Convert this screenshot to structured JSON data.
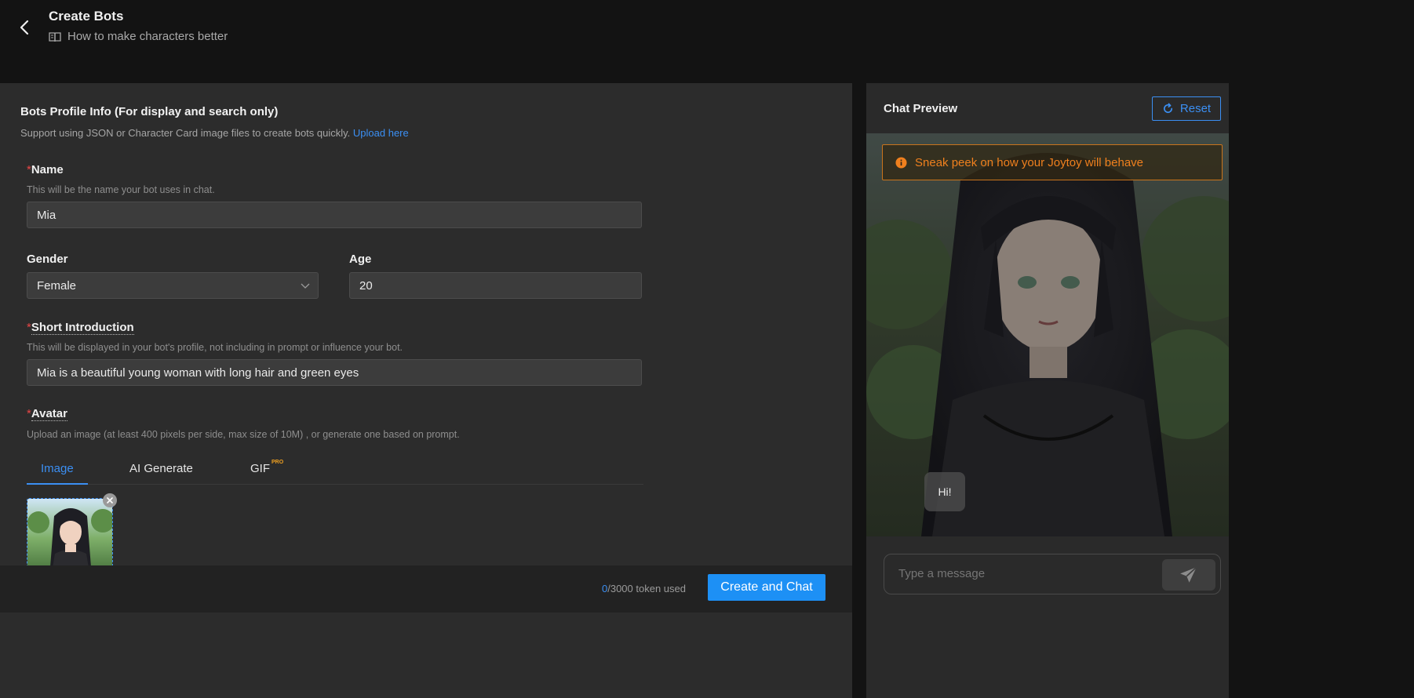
{
  "header": {
    "title": "Create Bots",
    "subtitle": "How to make characters better"
  },
  "profile": {
    "section_title": "Bots Profile Info (For display and search only)",
    "section_sub": "Support using JSON or Character Card image files to create bots quickly.",
    "upload_link": "Upload here",
    "required_mark": "*",
    "name": {
      "label": "Name",
      "help": "This will be the name your bot uses in chat.",
      "value": "Mia"
    },
    "gender": {
      "label": "Gender",
      "value": "Female"
    },
    "age": {
      "label": "Age",
      "value": "20"
    },
    "intro": {
      "label": "Short Introduction",
      "help": "This will be displayed in your bot's profile, not including in prompt or influence your bot.",
      "value": "Mia is a beautiful young woman with long hair and green eyes"
    },
    "avatar": {
      "label": "Avatar",
      "help": "Upload an image (at least 400 pixels per side, max size of 10M) , or generate one based on prompt.",
      "tabs": [
        "Image",
        "AI Generate",
        "GIF"
      ],
      "pro_badge": "PRO",
      "active_tab": "Image"
    }
  },
  "footer": {
    "token_used": "0",
    "token_total": "/3000 token used",
    "create_button": "Create and Chat"
  },
  "chat": {
    "title": "Chat Preview",
    "reset_button": "Reset",
    "notice": "Sneak peek on how your Joytoy will behave",
    "greeting": "Hi!",
    "input_placeholder": "Type a message"
  },
  "colors": {
    "accent": "#1d90f5",
    "link": "#3b8ff3",
    "warning": "#f0801e",
    "required": "#e64646"
  },
  "icons": {
    "back": "chevron-left-icon",
    "guide": "book-icon",
    "select": "chevron-down-icon",
    "remove": "close-icon",
    "reset": "refresh-icon",
    "notice": "info-icon",
    "send": "send-icon"
  }
}
